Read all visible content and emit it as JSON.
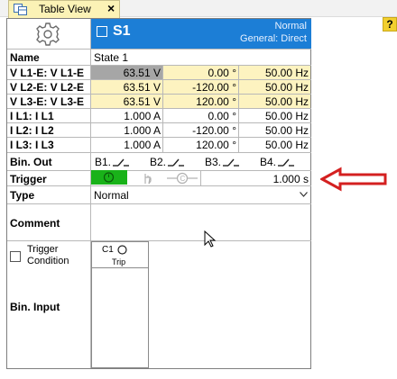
{
  "tab": {
    "title": "Table View",
    "close_label": "×"
  },
  "help_label": "?",
  "state": {
    "title": "S1",
    "mode": "Normal",
    "source": "General: Direct"
  },
  "rows": {
    "name": {
      "label": "Name",
      "value": "State 1"
    },
    "v1": {
      "label": "V L1-E: V L1-E",
      "magnitude": "63.51 V",
      "phase": "0.00 °",
      "frequency": "50.00 Hz"
    },
    "v2": {
      "label": "V L2-E: V L2-E",
      "magnitude": "63.51 V",
      "phase": "-120.00 °",
      "frequency": "50.00 Hz"
    },
    "v3": {
      "label": "V L3-E: V L3-E",
      "magnitude": "63.51 V",
      "phase": "120.00 °",
      "frequency": "50.00 Hz"
    },
    "i1": {
      "label": "I L1: I L1",
      "magnitude": "1.000 A",
      "phase": "0.00 °",
      "frequency": "50.00 Hz"
    },
    "i2": {
      "label": "I L2: I L2",
      "magnitude": "1.000 A",
      "phase": "-120.00 °",
      "frequency": "50.00 Hz"
    },
    "i3": {
      "label": "I L3: I L3",
      "magnitude": "1.000 A",
      "phase": "120.00 °",
      "frequency": "50.00 Hz"
    },
    "bin_out": {
      "label": "Bin. Out",
      "outputs": [
        "B1.",
        "B2.",
        "B3.",
        "B4."
      ]
    },
    "trigger": {
      "label": "Trigger",
      "time": "1.000 s"
    },
    "type": {
      "label": "Type",
      "value": "Normal"
    },
    "comment": {
      "label": "Comment"
    },
    "trigger_condition": {
      "label_line1": "Trigger",
      "label_line2": "Condition"
    },
    "bin_input": {
      "label": "Bin. Input",
      "channel": "C1",
      "channel_name": "Trip"
    }
  },
  "colors": {
    "header_blue": "#1c7ed6",
    "value_yellow": "#fdf3c0",
    "trigger_green": "#19b219",
    "arrow_red": "#d42020",
    "tab_yellow": "#fbf2b6"
  }
}
